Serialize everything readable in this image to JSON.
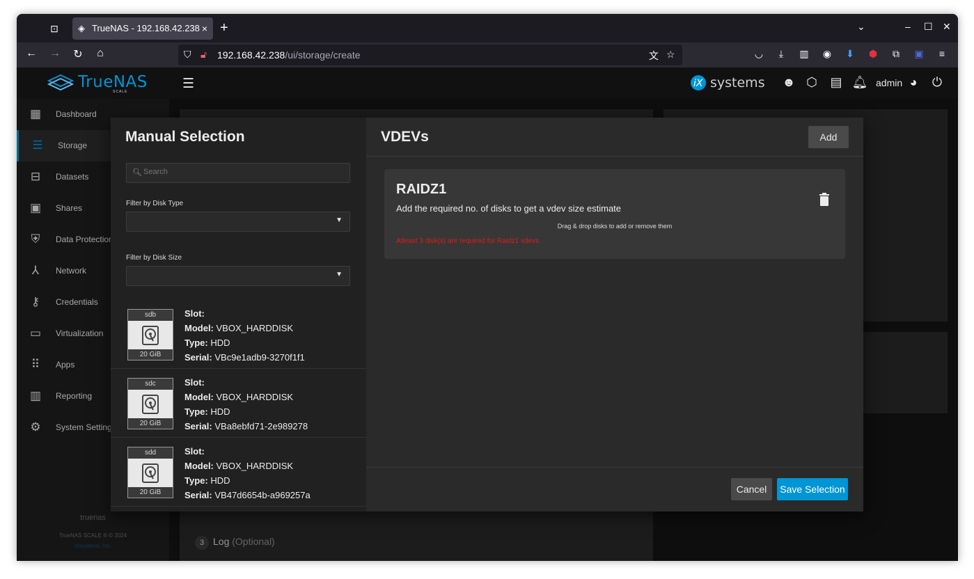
{
  "browser": {
    "tab_title": "TrueNAS - 192.168.42.238",
    "url_host": "192.168.42.238",
    "url_path": "/ui/storage/create",
    "download_badge": "0"
  },
  "header": {
    "logo_text": "TrueNAS",
    "logo_sub": "SCALE",
    "ix_text": "systems",
    "username": "admin"
  },
  "sidebar": {
    "items": [
      {
        "label": "Dashboard",
        "icon": "dashboard-icon"
      },
      {
        "label": "Storage",
        "icon": "storage-icon"
      },
      {
        "label": "Datasets",
        "icon": "datasets-icon"
      },
      {
        "label": "Shares",
        "icon": "shares-icon"
      },
      {
        "label": "Data Protection",
        "icon": "shield-icon"
      },
      {
        "label": "Network",
        "icon": "network-icon"
      },
      {
        "label": "Credentials",
        "icon": "key-icon"
      },
      {
        "label": "Virtualization",
        "icon": "laptop-icon"
      },
      {
        "label": "Apps",
        "icon": "apps-grid-icon"
      },
      {
        "label": "Reporting",
        "icon": "bar-chart-icon"
      },
      {
        "label": "System Settings",
        "icon": "gear-icon"
      }
    ],
    "hostname": "truenas",
    "copyright": "TrueNAS SCALE ® © 2024",
    "company": "iXsystems, Inc."
  },
  "background": {
    "step_log_num": "3",
    "step_log_label": "Log",
    "step_log_optional": "(Optional)"
  },
  "dialog": {
    "title": "Manual Selection",
    "search_placeholder": "Search",
    "filter_type_label": "Filter by Disk Type",
    "filter_size_label": "Filter by Disk Size",
    "disks": [
      {
        "name": "sdb",
        "size": "20 GiB",
        "slot": "",
        "model": "VBOX_HARDDISK",
        "type": "HDD",
        "serial": "VBc9e1adb9-3270f1f1"
      },
      {
        "name": "sdc",
        "size": "20 GiB",
        "slot": "",
        "model": "VBOX_HARDDISK",
        "type": "HDD",
        "serial": "VBa8ebfd71-2e989278"
      },
      {
        "name": "sdd",
        "size": "20 GiB",
        "slot": "",
        "model": "VBOX_HARDDISK",
        "type": "HDD",
        "serial": "VB47d6654b-a969257a"
      }
    ],
    "labels": {
      "slot": "Slot:",
      "model": "Model:",
      "type": "Type:",
      "serial": "Serial:"
    },
    "vdevs_title": "VDEVs",
    "add_label": "Add",
    "vdev": {
      "title": "RAIDZ1",
      "subtitle": "Add the required no. of disks to get a vdev size estimate",
      "drag_hint": "Drag & drop disks to add or remove them",
      "error": "Atleast 3 disk(s) are required for Raidz1 vdevs"
    },
    "cancel_label": "Cancel",
    "save_label": "Save Selection"
  },
  "colors": {
    "accent": "#0095d5",
    "error": "#e21b1b"
  }
}
